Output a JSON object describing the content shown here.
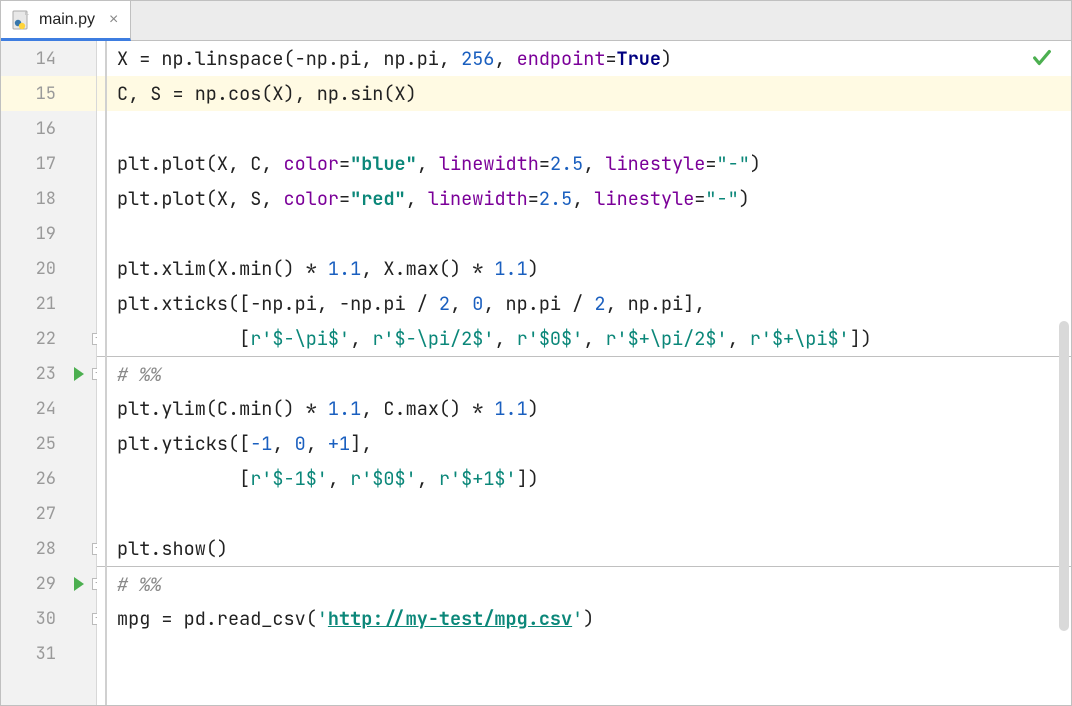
{
  "tab": {
    "filename": "main.py",
    "close_glyph": "×"
  },
  "status": {
    "check_ok": true
  },
  "lines": [
    {
      "num": "14",
      "run": false,
      "fold": false,
      "sep": false,
      "highlight": false,
      "tokens": [
        {
          "t": "X = np.linspace(-np.pi, np.pi, "
        },
        {
          "t": "256",
          "c": "k-num"
        },
        {
          "t": ", "
        },
        {
          "t": "endpoint",
          "c": "k-kw"
        },
        {
          "t": "="
        },
        {
          "t": "True",
          "c": "k-true"
        },
        {
          "t": ")"
        }
      ]
    },
    {
      "num": "15",
      "run": false,
      "fold": false,
      "sep": false,
      "highlight": true,
      "tokens": [
        {
          "t": "C, S = np.cos(X), np.sin(X)"
        }
      ]
    },
    {
      "num": "16",
      "run": false,
      "fold": false,
      "sep": false,
      "highlight": false,
      "tokens": []
    },
    {
      "num": "17",
      "run": false,
      "fold": false,
      "sep": false,
      "highlight": false,
      "tokens": [
        {
          "t": "plt.plot(X, C, "
        },
        {
          "t": "color",
          "c": "k-kw"
        },
        {
          "t": "="
        },
        {
          "t": "\"blue\"",
          "c": "k-strb"
        },
        {
          "t": ", "
        },
        {
          "t": "linewidth",
          "c": "k-kw"
        },
        {
          "t": "="
        },
        {
          "t": "2.5",
          "c": "k-num"
        },
        {
          "t": ", "
        },
        {
          "t": "linestyle",
          "c": "k-kw"
        },
        {
          "t": "="
        },
        {
          "t": "\"-\"",
          "c": "k-str"
        },
        {
          "t": ")"
        }
      ]
    },
    {
      "num": "18",
      "run": false,
      "fold": false,
      "sep": false,
      "highlight": false,
      "tokens": [
        {
          "t": "plt.plot(X, S, "
        },
        {
          "t": "color",
          "c": "k-kw"
        },
        {
          "t": "="
        },
        {
          "t": "\"red\"",
          "c": "k-strb"
        },
        {
          "t": ", "
        },
        {
          "t": "linewidth",
          "c": "k-kw"
        },
        {
          "t": "="
        },
        {
          "t": "2.5",
          "c": "k-num"
        },
        {
          "t": ", "
        },
        {
          "t": "linestyle",
          "c": "k-kw"
        },
        {
          "t": "="
        },
        {
          "t": "\"-\"",
          "c": "k-str"
        },
        {
          "t": ")"
        }
      ]
    },
    {
      "num": "19",
      "run": false,
      "fold": false,
      "sep": false,
      "highlight": false,
      "tokens": []
    },
    {
      "num": "20",
      "run": false,
      "fold": false,
      "sep": false,
      "highlight": false,
      "tokens": [
        {
          "t": "plt.xlim(X.min() * "
        },
        {
          "t": "1.1",
          "c": "k-num"
        },
        {
          "t": ", X.max() * "
        },
        {
          "t": "1.1",
          "c": "k-num"
        },
        {
          "t": ")"
        }
      ]
    },
    {
      "num": "21",
      "run": false,
      "fold": false,
      "sep": false,
      "highlight": false,
      "tokens": [
        {
          "t": "plt.xticks([-np.pi, -np.pi / "
        },
        {
          "t": "2",
          "c": "k-num"
        },
        {
          "t": ", "
        },
        {
          "t": "0",
          "c": "k-num"
        },
        {
          "t": ", np.pi / "
        },
        {
          "t": "2",
          "c": "k-num"
        },
        {
          "t": ", np.pi],"
        }
      ]
    },
    {
      "num": "22",
      "run": false,
      "fold": true,
      "sep": false,
      "highlight": false,
      "tokens": [
        {
          "t": "           ["
        },
        {
          "t": "r'$-\\pi$'",
          "c": "k-str"
        },
        {
          "t": ", "
        },
        {
          "t": "r'$-\\pi/2$'",
          "c": "k-str"
        },
        {
          "t": ", "
        },
        {
          "t": "r'$0$'",
          "c": "k-str"
        },
        {
          "t": ", "
        },
        {
          "t": "r'$+\\pi/2$'",
          "c": "k-str"
        },
        {
          "t": ", "
        },
        {
          "t": "r'$+\\pi$'",
          "c": "k-str"
        },
        {
          "t": "])"
        }
      ]
    },
    {
      "num": "23",
      "run": true,
      "fold": true,
      "sep": true,
      "highlight": false,
      "tokens": [
        {
          "t": "# %%",
          "c": "k-cm"
        }
      ]
    },
    {
      "num": "24",
      "run": false,
      "fold": false,
      "sep": false,
      "highlight": false,
      "tokens": [
        {
          "t": "plt.ylim(C.min() * "
        },
        {
          "t": "1.1",
          "c": "k-num"
        },
        {
          "t": ", C.max() * "
        },
        {
          "t": "1.1",
          "c": "k-num"
        },
        {
          "t": ")"
        }
      ]
    },
    {
      "num": "25",
      "run": false,
      "fold": false,
      "sep": false,
      "highlight": false,
      "tokens": [
        {
          "t": "plt.yticks(["
        },
        {
          "t": "-1",
          "c": "k-num"
        },
        {
          "t": ", "
        },
        {
          "t": "0",
          "c": "k-num"
        },
        {
          "t": ", "
        },
        {
          "t": "+1",
          "c": "k-num"
        },
        {
          "t": "],"
        }
      ]
    },
    {
      "num": "26",
      "run": false,
      "fold": false,
      "sep": false,
      "highlight": false,
      "tokens": [
        {
          "t": "           ["
        },
        {
          "t": "r'$-1$'",
          "c": "k-str"
        },
        {
          "t": ", "
        },
        {
          "t": "r'$0$'",
          "c": "k-str"
        },
        {
          "t": ", "
        },
        {
          "t": "r'$+1$'",
          "c": "k-str"
        },
        {
          "t": "])"
        }
      ]
    },
    {
      "num": "27",
      "run": false,
      "fold": false,
      "sep": false,
      "highlight": false,
      "tokens": []
    },
    {
      "num": "28",
      "run": false,
      "fold": true,
      "sep": false,
      "highlight": false,
      "tokens": [
        {
          "t": "plt.show()"
        }
      ]
    },
    {
      "num": "29",
      "run": true,
      "fold": true,
      "sep": true,
      "highlight": false,
      "tokens": [
        {
          "t": "# %%",
          "c": "k-cm"
        }
      ]
    },
    {
      "num": "30",
      "run": false,
      "fold": true,
      "sep": false,
      "highlight": false,
      "tokens": [
        {
          "t": "mpg = pd.read_csv("
        },
        {
          "t": "'",
          "c": "k-str"
        },
        {
          "t": "http://my-test/mpg.csv",
          "c": "k-strl"
        },
        {
          "t": "'",
          "c": "k-str"
        },
        {
          "t": ")"
        }
      ]
    },
    {
      "num": "31",
      "run": false,
      "fold": false,
      "sep": false,
      "highlight": false,
      "tokens": []
    }
  ]
}
